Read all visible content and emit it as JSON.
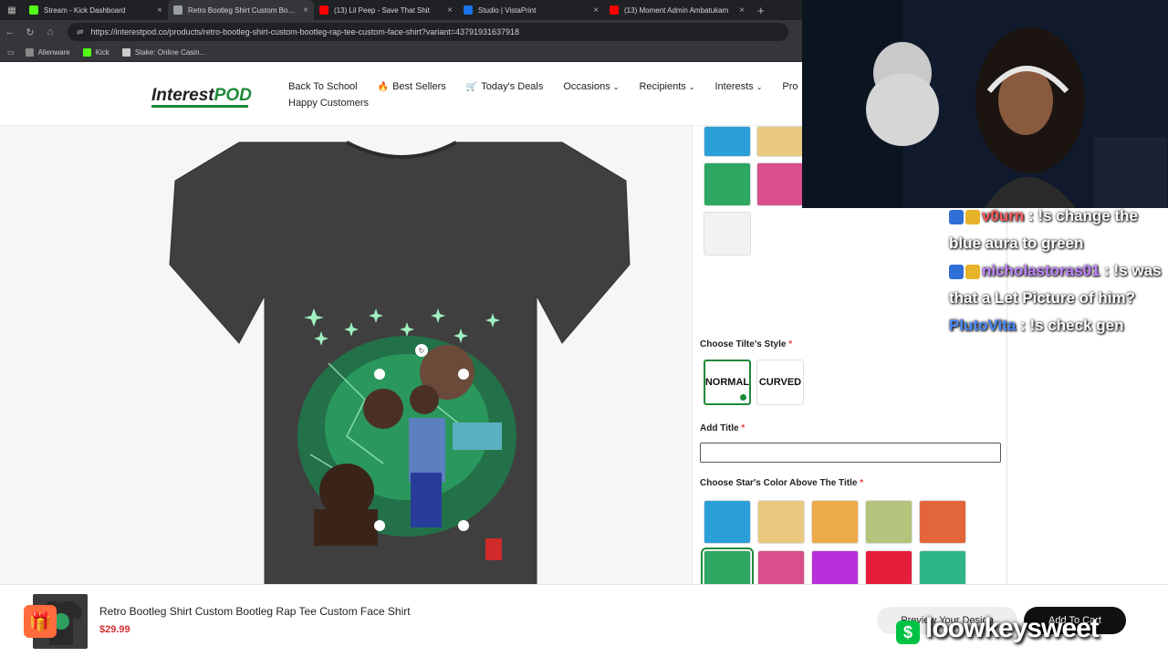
{
  "browser": {
    "tabs": [
      {
        "label": "Stream - Kick Dashboard",
        "favicon_color": "#53fc18",
        "active": false
      },
      {
        "label": "Retro Bootleg Shirt Custom Bootle",
        "favicon_color": "#9aa0a6",
        "active": true
      },
      {
        "label": "(13) Lil Peep - Save That Shit",
        "favicon_color": "#ff0000",
        "active": false
      },
      {
        "label": "Studio | VistaPrint",
        "favicon_color": "#1a73e8",
        "active": false
      },
      {
        "label": "(13) Moment Admin Ambatukam",
        "favicon_color": "#ff0000",
        "active": false
      }
    ],
    "url": "https://interestpod.co/products/retro-bootleg-shirt-custom-bootleg-rap-tee-custom-face-shirt?variant=43791931637918",
    "bookmarks": [
      {
        "label": "Alienware",
        "icon_color": "#888888"
      },
      {
        "label": "Kick",
        "icon_color": "#53fc18"
      },
      {
        "label": "Stake: Online Casin...",
        "icon_color": "#cccccc"
      }
    ]
  },
  "site": {
    "logo_main": "Interest",
    "logo_accent": "POD",
    "nav_row1": [
      {
        "label": "Back To School",
        "emoji": "",
        "caret": false
      },
      {
        "label": "Best Sellers",
        "emoji": "🔥",
        "caret": false
      },
      {
        "label": "Today's Deals",
        "emoji": "🛒",
        "caret": false
      },
      {
        "label": "Occasions",
        "emoji": "",
        "caret": true
      },
      {
        "label": "Recipients",
        "emoji": "",
        "caret": true
      },
      {
        "label": "Interests",
        "emoji": "",
        "caret": true
      },
      {
        "label": "Pro",
        "emoji": "",
        "caret": false
      }
    ],
    "nav_row2": [
      "Happy Customers"
    ]
  },
  "options": {
    "top_swatches": [
      "#2b9fd8",
      "#e8c97f",
      "#2ca862",
      "#d84f8b",
      "#f2f2f2"
    ],
    "style_label": "Choose Tilte's Style",
    "style_options": [
      {
        "label": "NORMAL",
        "selected": true
      },
      {
        "label": "CURVED",
        "selected": false
      }
    ],
    "title_label": "Add Title",
    "title_value": "",
    "star_color_label": "Choose Star's Color Above The Title",
    "star_colors": [
      "#2b9fd8",
      "#e8c97f",
      "#eeab4a",
      "#b4c47c",
      "#e3663a",
      "#2ca862",
      "#d84f8b",
      "#b82fd9",
      "#e61e3c",
      "#2fb58a",
      "#f4f4f4"
    ],
    "required_mark": "*"
  },
  "bottom_bar": {
    "title": "Retro Bootleg Shirt Custom Bootleg Rap Tee Custom Face Shirt",
    "price": "$29.99",
    "preview_button": "Preview Your Design",
    "cart_button": "Add To Cart"
  },
  "stream_overlay": {
    "chat": [
      {
        "user": "v0urn",
        "user_color": "#ff5a5a",
        "message": " : !s change the blue aura to green"
      },
      {
        "user": "nicholastoras01",
        "user_color": "#c084ff",
        "message": " : !s was that a Let Picture of him?"
      },
      {
        "user": "PlutoVita",
        "user_color": "#4a8cff",
        "message": " : !s check gen"
      }
    ],
    "watermark": "loowkeysweet"
  }
}
